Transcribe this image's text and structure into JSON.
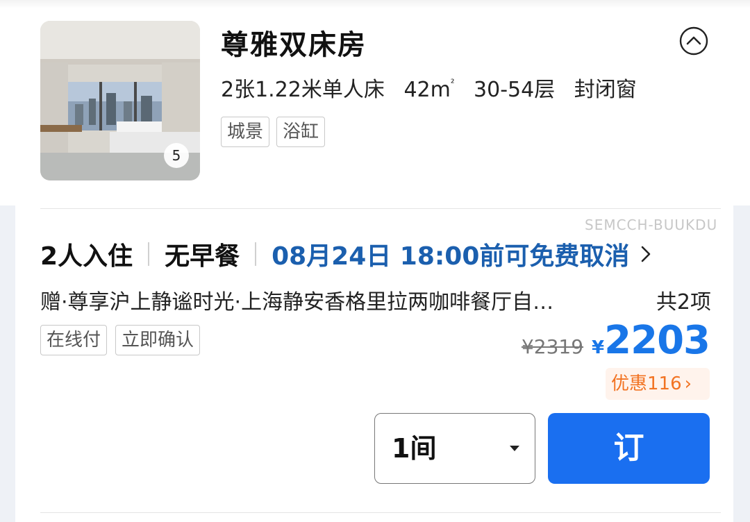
{
  "room": {
    "title": "尊雅双床房",
    "beds": "2张1.22米单人床",
    "area": "42m",
    "area_sup": "²",
    "floors": "30-54层",
    "window": "封闭窗",
    "tags": [
      "城景",
      "浴缸"
    ],
    "photo_count": "5"
  },
  "watermark": "SEMCCH-BUUKDU",
  "offer": {
    "guests": "2人入住",
    "breakfast": "无早餐",
    "cancel_policy": "08月24日 18:00前可免费取消",
    "gift_text": "赠·尊享沪上静谧时光·上海静安香格里拉两咖啡餐厅自…",
    "gift_count": "共2项",
    "tags": [
      "在线付",
      "立即确认"
    ],
    "original_price": "¥2319",
    "currency": "¥",
    "price": "2203",
    "discount": "优惠116",
    "discount_arrow": "›",
    "room_qty": "1间",
    "book_label": "订"
  },
  "colors": {
    "accent_blue": "#1a6ff0",
    "cancel_blue": "#1b5fae",
    "discount_orange": "#f27322"
  }
}
